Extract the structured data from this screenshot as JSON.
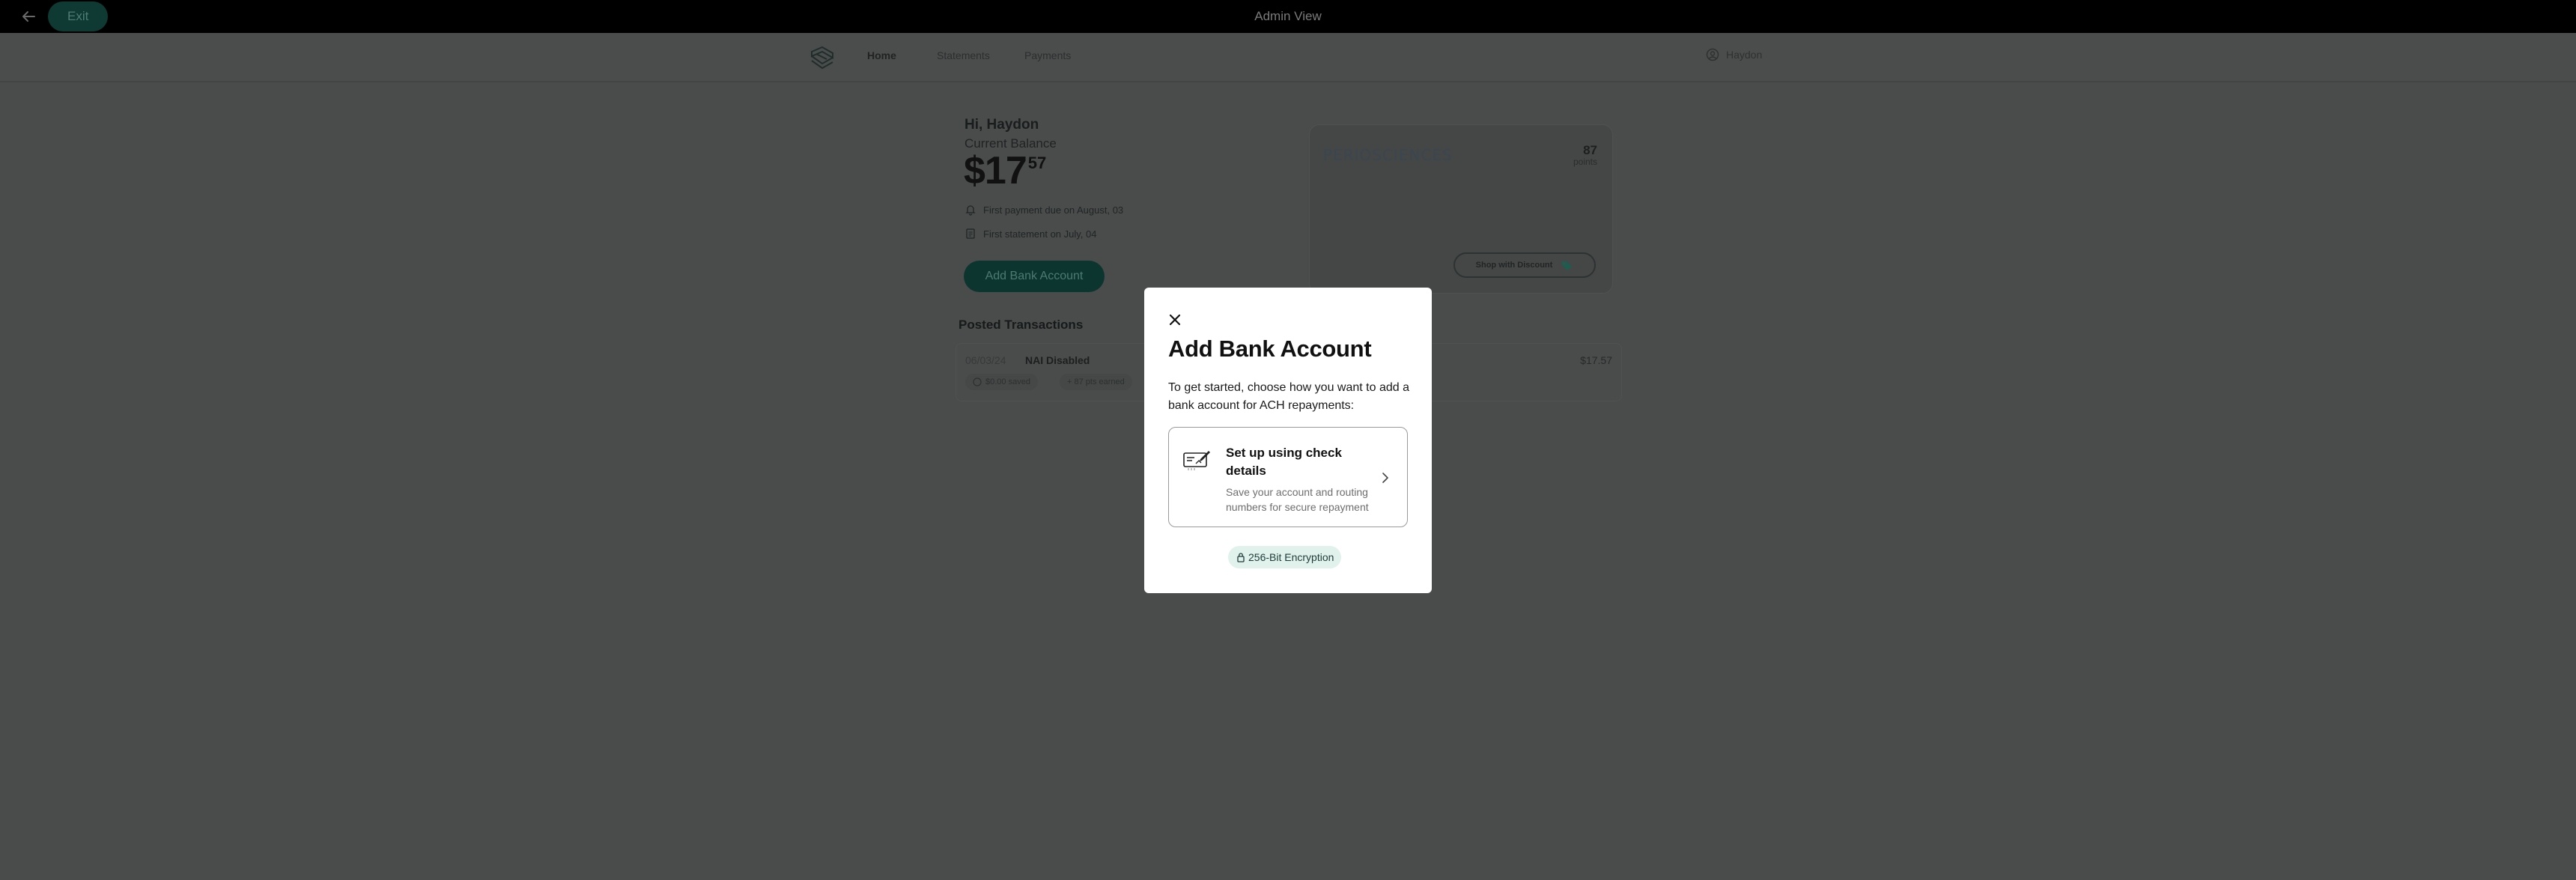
{
  "admin_bar": {
    "exit_label": "Exit",
    "title": "Admin View"
  },
  "nav": {
    "tabs": [
      {
        "label": "Home",
        "active": true
      },
      {
        "label": "Statements",
        "active": false
      },
      {
        "label": "Payments",
        "active": false
      }
    ],
    "user_name": "Haydon"
  },
  "summary": {
    "greeting": "Hi, Haydon",
    "balance_label": "Current Balance",
    "balance_dollars": "$17",
    "balance_cents": "57",
    "payment_due": "First payment due on August, 03",
    "statement_on": "First statement on July, 04",
    "add_bank_label": "Add Bank Account"
  },
  "rewards": {
    "brand": "PERIOSCIENCES",
    "points": "87",
    "points_label": "points",
    "shop_label": "Shop with Discount"
  },
  "transactions": {
    "title": "Posted Transactions",
    "items": [
      {
        "date": "06/03/24",
        "name": "NAI Disabled",
        "amount": "$17.57",
        "saved": "$0.00 saved",
        "earned": "+ 87 pts earned"
      }
    ]
  },
  "modal": {
    "title": "Add Bank Account",
    "description": "To get started, choose how you want to add a bank account for ACH repayments:",
    "option": {
      "title": "Set up using check details",
      "description": "Save your account and routing numbers for secure repayment"
    },
    "encryption": "256-Bit Encryption"
  },
  "colors": {
    "accent_dark": "#0d3530",
    "overlay": "#4a4b4b",
    "badge_bg": "#e1f2ec"
  },
  "icons": [
    "arrow-left-icon",
    "logo-icon",
    "user-icon",
    "bell-icon",
    "document-icon",
    "tag-icon",
    "close-icon",
    "check-icon",
    "chevron-right-icon",
    "lock-icon"
  ]
}
